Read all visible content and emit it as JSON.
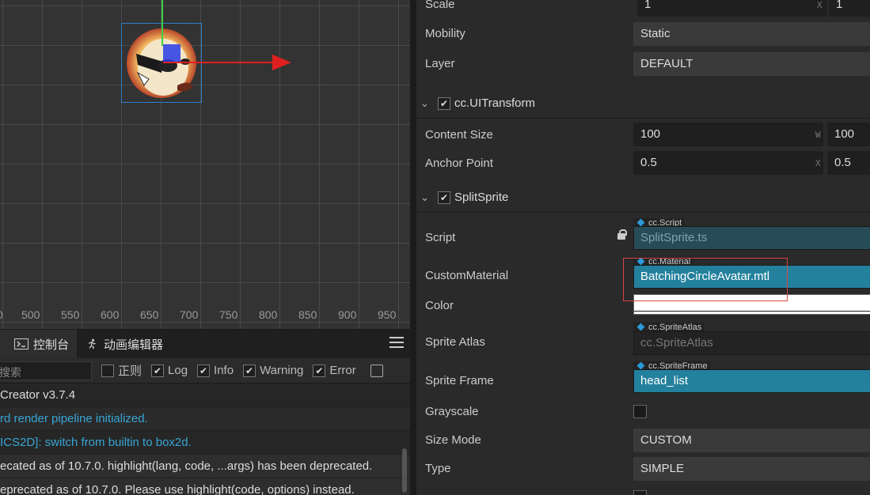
{
  "scene": {
    "ruler_ticks": [
      "0",
      "500",
      "550",
      "600",
      "650",
      "700",
      "750",
      "800",
      "850",
      "900",
      "950"
    ]
  },
  "console": {
    "tabs": [
      {
        "label": "控制台",
        "icon": "terminal-icon"
      },
      {
        "label": "动画编辑器",
        "icon": "animation-runner-icon"
      }
    ],
    "search_placeholder": "搜索",
    "filters": [
      {
        "label": "正则",
        "checked": false
      },
      {
        "label": "Log",
        "checked": true
      },
      {
        "label": "Info",
        "checked": true
      },
      {
        "label": "Warning",
        "checked": true
      },
      {
        "label": "Error",
        "checked": true
      }
    ],
    "logs": [
      " Creator v3.7.4",
      "rd render pipeline initialized.",
      "ICS2D]: switch from builtin to box2d.",
      "ecated as of 10.7.0. highlight(lang, code, ...args) has been deprecated.",
      "eprecated as of 10.7.0. Please use highlight(code, options) instead."
    ]
  },
  "inspector": {
    "scale": {
      "label": "Scale",
      "x": "1",
      "y": "1",
      "axis": "X"
    },
    "mobility": {
      "label": "Mobility",
      "value": "Static"
    },
    "layer": {
      "label": "Layer",
      "value": "DEFAULT"
    },
    "uitransform": {
      "title": "cc.UITransform",
      "content_size": {
        "label": "Content Size",
        "w": "100",
        "h": "100",
        "axis": "W"
      },
      "anchor_point": {
        "label": "Anchor Point",
        "x": "0.5",
        "y": "0.5",
        "axis": "X"
      }
    },
    "splitsprite": {
      "title": "SplitSprite",
      "script": {
        "label": "Script",
        "type": "cc.Script",
        "value": "SplitSprite.ts"
      },
      "custom_material": {
        "label": "CustomMaterial",
        "type": "cc.Material",
        "value": "BatchingCircleAvatar.mtl"
      },
      "color": {
        "label": "Color"
      },
      "sprite_atlas": {
        "label": "Sprite Atlas",
        "type": "cc.SpriteAtlas",
        "value": "cc.SpriteAtlas"
      },
      "sprite_frame": {
        "label": "Sprite Frame",
        "type": "cc.SpriteFrame",
        "value": "head_list"
      },
      "grayscale": {
        "label": "Grayscale",
        "checked": false
      },
      "size_mode": {
        "label": "Size Mode",
        "value": "CUSTOM"
      },
      "type": {
        "label": "Type",
        "value": "SIMPLE"
      }
    }
  }
}
